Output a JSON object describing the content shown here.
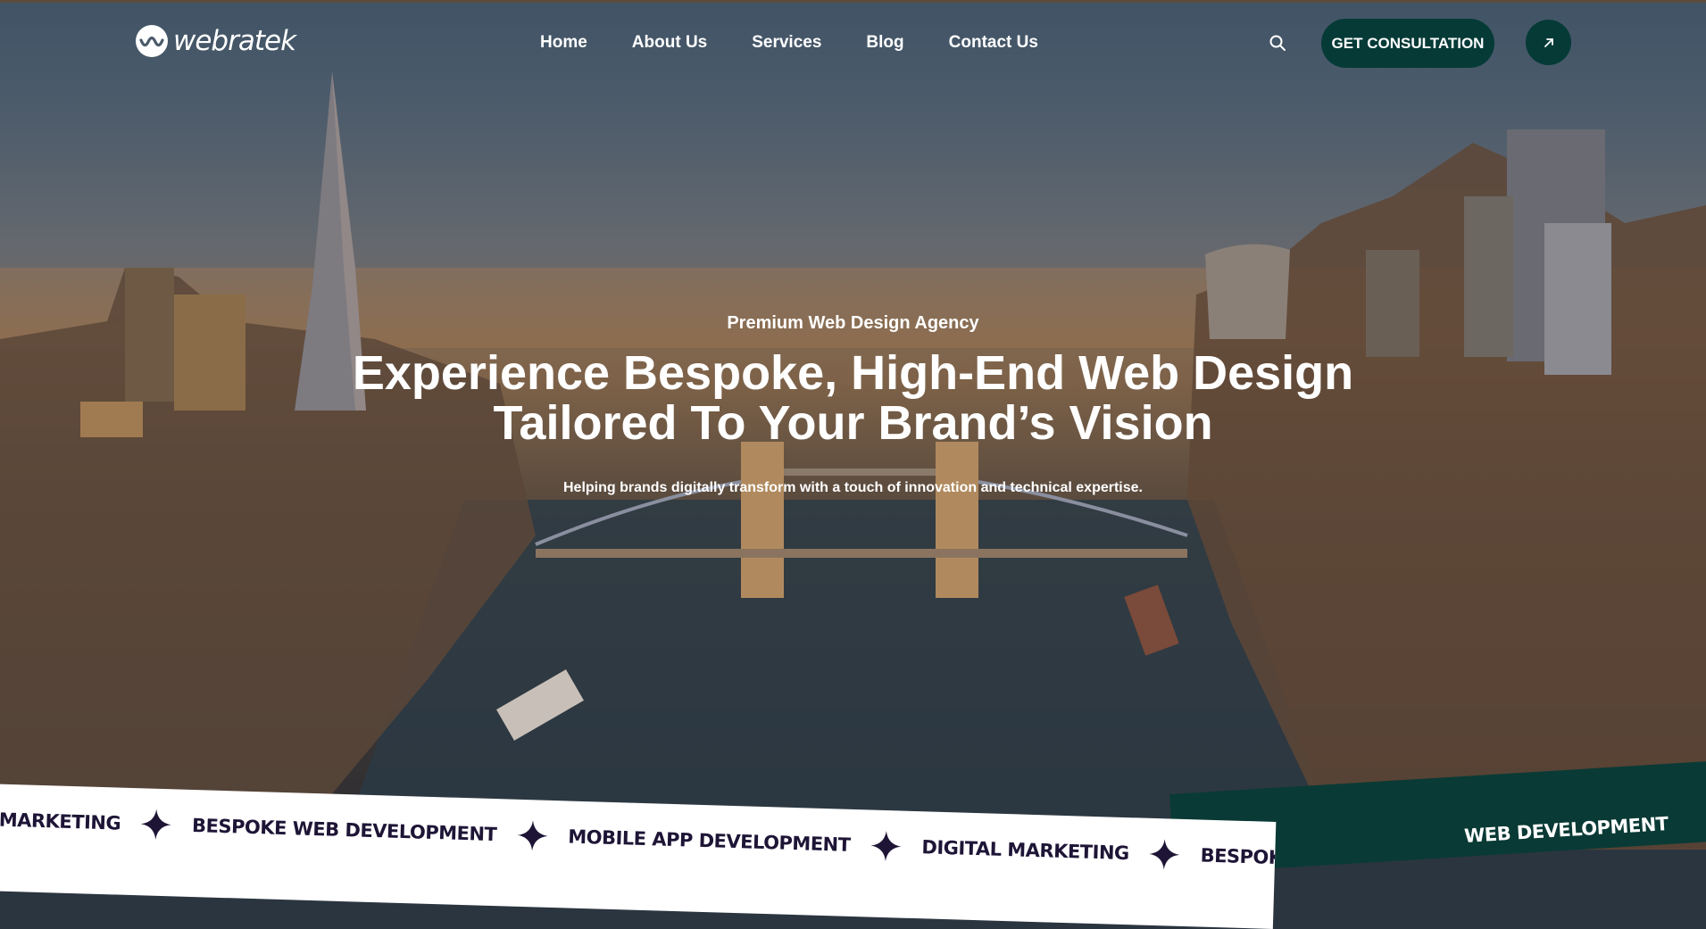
{
  "brand": {
    "name": "webratek"
  },
  "nav": {
    "items": [
      "Home",
      "About Us",
      "Services",
      "Blog",
      "Contact Us"
    ],
    "cta_label": "GET CONSULTATION"
  },
  "hero": {
    "eyebrow": "Premium Web Design Agency",
    "headline_line1": "Experience Bespoke, High-End Web Design",
    "headline_line2": "Tailored To Your Brand’s Vision",
    "subtitle": "Helping brands digitally transform with a touch of innovation and technical expertise."
  },
  "ticker": {
    "items": [
      "MARKETING",
      "BESPOKE WEB DEVELOPMENT",
      "MOBILE APP DEVELOPMENT",
      "DIGITAL MARKETING",
      "BESPOKE WEB"
    ],
    "green_text": "WEB DEVELOPMENT"
  },
  "colors": {
    "accent": "#053a37",
    "ticker_text": "#1e1536",
    "ticker_green": "#0a3a35"
  },
  "icons": [
    "search-icon",
    "arrow-up-right-icon",
    "star-icon",
    "logo-wave-icon"
  ]
}
